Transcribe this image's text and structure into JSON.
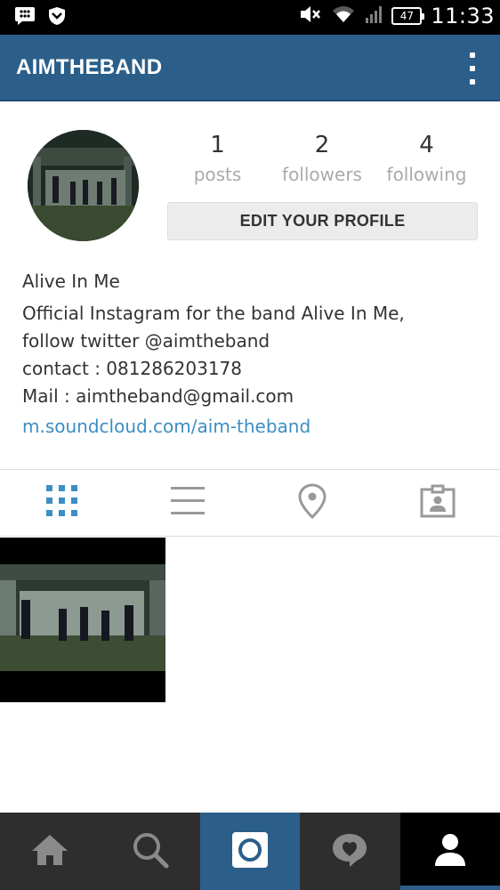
{
  "status_bar": {
    "time": "11:33",
    "battery": "47",
    "icons": [
      "bbm-icon",
      "shield-icon",
      "mute-icon",
      "wifi-icon",
      "signal-icon",
      "battery-icon"
    ]
  },
  "app_bar": {
    "title": "AIMTHEBAND",
    "menu_icon": "overflow-menu-icon"
  },
  "profile": {
    "stats": [
      {
        "value": "1",
        "label": "posts"
      },
      {
        "value": "2",
        "label": "followers"
      },
      {
        "value": "4",
        "label": "following"
      }
    ],
    "edit_button": "EDIT YOUR PROFILE",
    "name": "Alive In Me",
    "bio_lines": [
      "Official Instagram for the band Alive In Me,",
      "follow twitter @aimtheband",
      "contact : 081286203178",
      "Mail : aimtheband@gmail.com"
    ],
    "website": "m.soundcloud.com/aim-theband"
  },
  "tabs": [
    {
      "name": "grid-view",
      "icon": "grid-icon",
      "selected": true
    },
    {
      "name": "list-view",
      "icon": "list-icon",
      "selected": false
    },
    {
      "name": "map-view",
      "icon": "location-pin-icon",
      "selected": false
    },
    {
      "name": "tagged-view",
      "icon": "tagged-photos-icon",
      "selected": false
    }
  ],
  "bottom_nav": [
    {
      "name": "home",
      "icon": "home-icon"
    },
    {
      "name": "explore",
      "icon": "search-icon"
    },
    {
      "name": "camera",
      "icon": "camera-icon"
    },
    {
      "name": "activity",
      "icon": "heart-bubble-icon"
    },
    {
      "name": "profile",
      "icon": "person-icon",
      "active": true
    }
  ],
  "colors": {
    "brand": "#2b5f8a",
    "link": "#3d8ec4",
    "tab_active": "#3d8ec4",
    "tab_inactive": "#999999",
    "nav_bg": "#2e2e2e"
  }
}
